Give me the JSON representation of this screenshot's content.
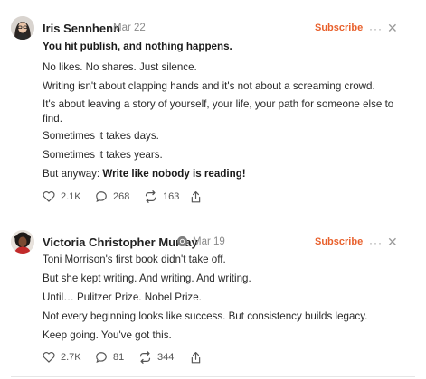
{
  "posts": [
    {
      "author": "Iris Sennhenn",
      "date": "Mar 22",
      "subscribe": "Subscribe",
      "more": "···",
      "close": "✕",
      "paragraphs": [
        "You hit publish, and nothing happens.",
        "No likes. No shares. Just silence.",
        "Writing isn't about clapping hands and it's not about a screaming crowd.",
        "It's about leaving a story of yourself, your life, your path for someone else to find.",
        "Sometimes it takes days.",
        "Sometimes it takes years."
      ],
      "last_line_prefix": "But anyway: ",
      "last_line_bold": "Write like nobody is reading!",
      "likes": "2.1K",
      "comments": "268",
      "restacks": "163",
      "icons": [
        "heart-icon",
        "comment-icon",
        "restack-icon",
        "share-icon"
      ]
    },
    {
      "author": "Victoria Christopher Murray",
      "date": "Mar 19",
      "subscribe": "Subscribe",
      "more": "···",
      "close": "✕",
      "paragraphs": [
        "Toni Morrison's first book didn't take off.",
        "But she kept writing. And writing. And writing.",
        "Until… Pulitzer Prize. Nobel Prize.",
        "Not every beginning looks like success. But consistency builds legacy.",
        "Keep going. You've got this."
      ],
      "likes": "2.7K",
      "comments": "81",
      "restacks": "344",
      "icons": [
        "heart-icon",
        "comment-icon",
        "restack-icon",
        "share-icon"
      ]
    }
  ],
  "colors": {
    "accent": "#e8602c",
    "muted": "#8a8a8a",
    "divider": "#e6e6e6"
  }
}
